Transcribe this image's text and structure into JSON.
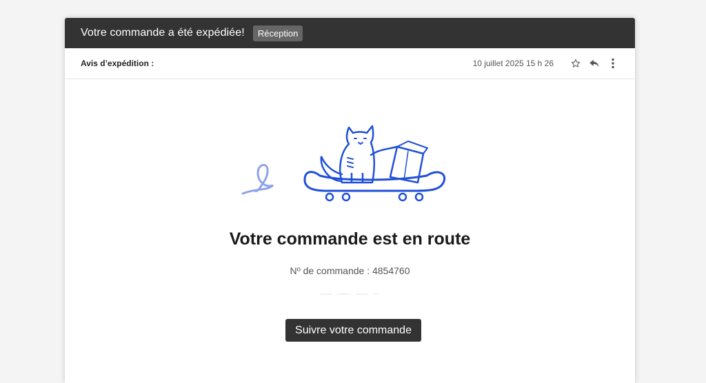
{
  "email": {
    "subject": "Votre commande a été expédiée!",
    "label": "Réception",
    "sender": "Avis d’expédition :",
    "date": "10 juillet 2025 15 h 26"
  },
  "icons": [
    "star-icon",
    "reply-icon",
    "more-vertical-icon"
  ],
  "body": {
    "headline": "Votre commande est en route",
    "order_number": "Nº de commande : 4854760",
    "button_label": "Suivre votre commande"
  },
  "colors": {
    "titlebar": "#333333",
    "illustration": "#1f4fd8",
    "button": "#333333"
  }
}
